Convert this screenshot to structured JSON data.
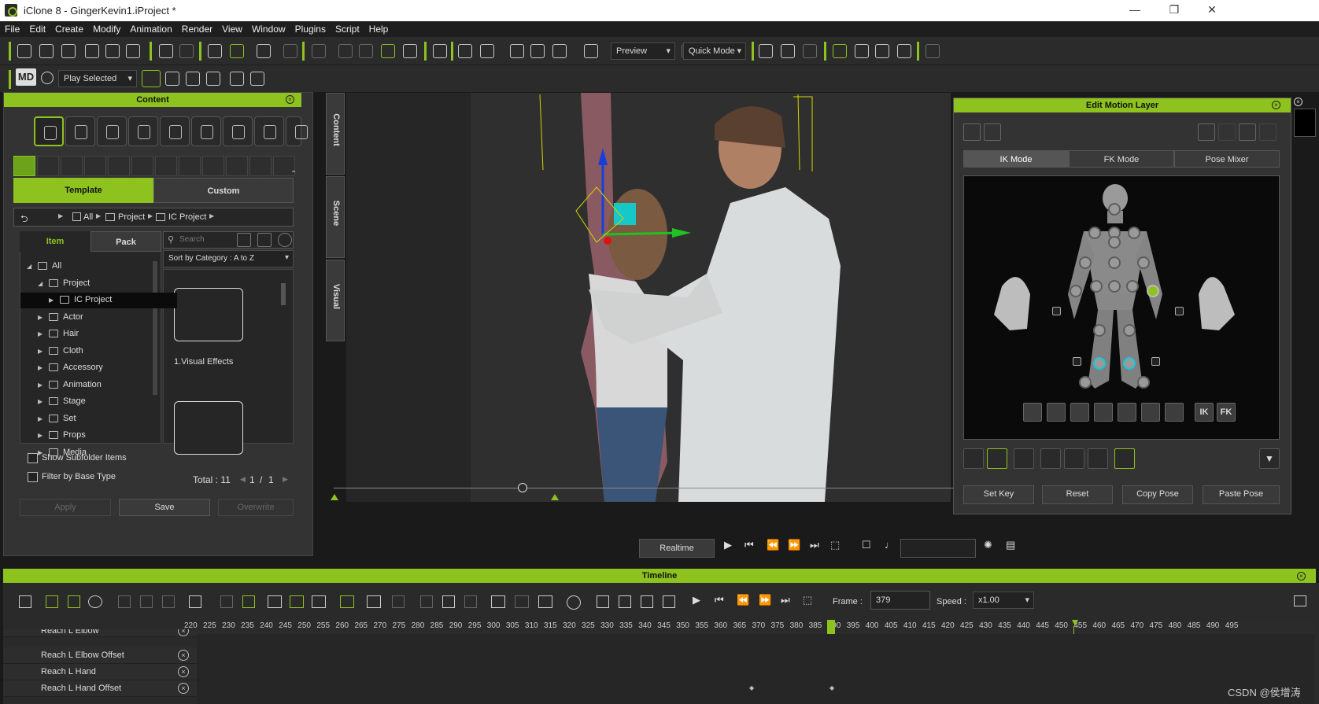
{
  "window": {
    "title": "iClone 8 - GingerKevin1.iProject *"
  },
  "menu": [
    "File",
    "Edit",
    "Create",
    "Modify",
    "Animation",
    "Render",
    "View",
    "Window",
    "Plugins",
    "Script",
    "Help"
  ],
  "toolbar": {
    "preview_label": "Preview",
    "quick_mode_label": "Quick Mode",
    "play_selected_label": "Play Selected"
  },
  "content_panel": {
    "title": "Content",
    "side_tabs": [
      "Content",
      "Scene",
      "Visual"
    ],
    "tabs": [
      "Template",
      "Custom"
    ],
    "breadcrumb": [
      "All",
      "Project",
      "IC Project"
    ],
    "subtabs": [
      "Item",
      "Pack"
    ],
    "search_placeholder": "Search",
    "sort_label": "Sort by Category : A to Z",
    "tree": [
      {
        "label": "All",
        "indent": 0,
        "arrow": "◢"
      },
      {
        "label": "Project",
        "indent": 1,
        "arrow": "◢"
      },
      {
        "label": "IC Project",
        "indent": 2,
        "arrow": "▶",
        "selected": true
      },
      {
        "label": "Actor",
        "indent": 1,
        "arrow": "▶"
      },
      {
        "label": "Hair",
        "indent": 1,
        "arrow": "▶"
      },
      {
        "label": "Cloth",
        "indent": 1,
        "arrow": "▶"
      },
      {
        "label": "Accessory",
        "indent": 1,
        "arrow": "▶"
      },
      {
        "label": "Animation",
        "indent": 1,
        "arrow": "▶"
      },
      {
        "label": "Stage",
        "indent": 1,
        "arrow": "▶"
      },
      {
        "label": "Set",
        "indent": 1,
        "arrow": "▶"
      },
      {
        "label": "Props",
        "indent": 1,
        "arrow": "▶"
      },
      {
        "label": "Media",
        "indent": 1,
        "arrow": "▶"
      }
    ],
    "item_label": "1.Visual Effects",
    "show_subfolder": "Show Subfolder Items",
    "filter_base": "Filter by Base Type",
    "total": "Total : 11",
    "page": "1",
    "page_sep": "/",
    "pages": "1",
    "apply": "Apply",
    "save": "Save",
    "overwrite": "Overwrite"
  },
  "edit_motion_layer": {
    "title": "Edit Motion Layer",
    "modes": [
      "IK Mode",
      "FK Mode",
      "Pose Mixer"
    ],
    "ik": "IK",
    "fk": "FK",
    "actions": [
      "Set Key",
      "Reset",
      "Copy Pose",
      "Paste Pose"
    ]
  },
  "playback": {
    "realtime": "Realtime"
  },
  "timeline": {
    "title": "Timeline",
    "frame_label": "Frame :",
    "frame_value": "379",
    "speed_label": "Speed :",
    "speed_value": "x1.00",
    "ruler": [
      "220",
      "225",
      "230",
      "235",
      "240",
      "245",
      "250",
      "255",
      "260",
      "265",
      "270",
      "275",
      "280",
      "285",
      "290",
      "295",
      "300",
      "305",
      "310",
      "315",
      "320",
      "325",
      "330",
      "335",
      "340",
      "345",
      "350",
      "355",
      "360",
      "365",
      "370",
      "375",
      "380",
      "385",
      "390",
      "395",
      "400",
      "405",
      "410",
      "415",
      "420",
      "425",
      "430",
      "435",
      "440",
      "445",
      "450",
      "455",
      "460",
      "465",
      "470",
      "475",
      "480",
      "485",
      "490",
      "495"
    ],
    "tracks": [
      "Reach L Elbow",
      "Reach L Elbow Offset",
      "Reach L Hand",
      "Reach L Hand Offset"
    ]
  },
  "watermark": "CSDN @侯增涛",
  "colors": {
    "accent": "#8dc21f",
    "ik_joint": "#16c8d8"
  }
}
